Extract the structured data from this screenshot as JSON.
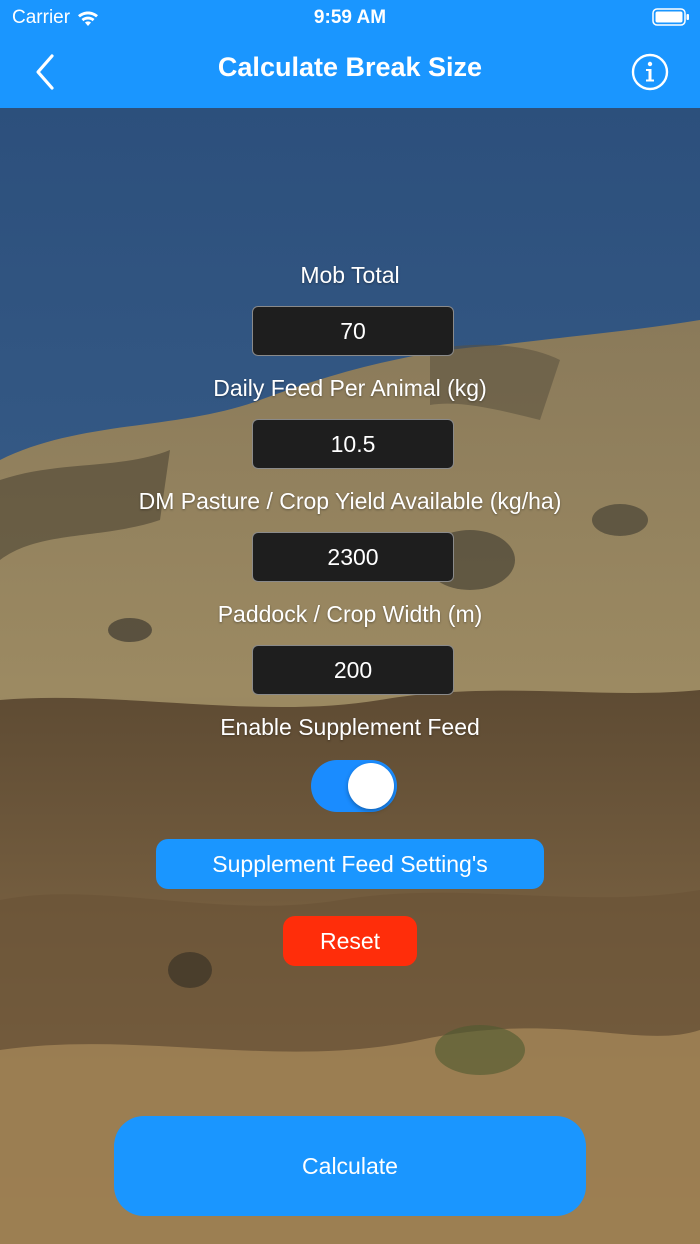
{
  "status_bar": {
    "carrier": "Carrier",
    "time": "9:59 AM",
    "wifi_icon": "wifi-icon",
    "battery_icon": "battery-icon"
  },
  "nav": {
    "title": "Calculate Break Size",
    "back_icon": "chevron-left-icon",
    "info_icon": "info-icon"
  },
  "form": {
    "mob_total": {
      "label": "Mob Total",
      "value": "70"
    },
    "daily_feed": {
      "label": "Daily Feed Per Animal (kg)",
      "value": "10.5"
    },
    "dm_pasture": {
      "label": "DM Pasture / Crop Yield Available (kg/ha)",
      "value": "2300"
    },
    "paddock_width": {
      "label": "Paddock / Crop Width (m)",
      "value": "200"
    },
    "supplement": {
      "label": "Enable Supplement Feed",
      "enabled": true
    }
  },
  "buttons": {
    "supplement_settings": "Supplement Feed Setting's",
    "reset": "Reset",
    "calculate": "Calculate"
  },
  "colors": {
    "accent": "#1a96ff",
    "danger": "#ff2d0a",
    "toggle_on": "#1a8cff"
  }
}
